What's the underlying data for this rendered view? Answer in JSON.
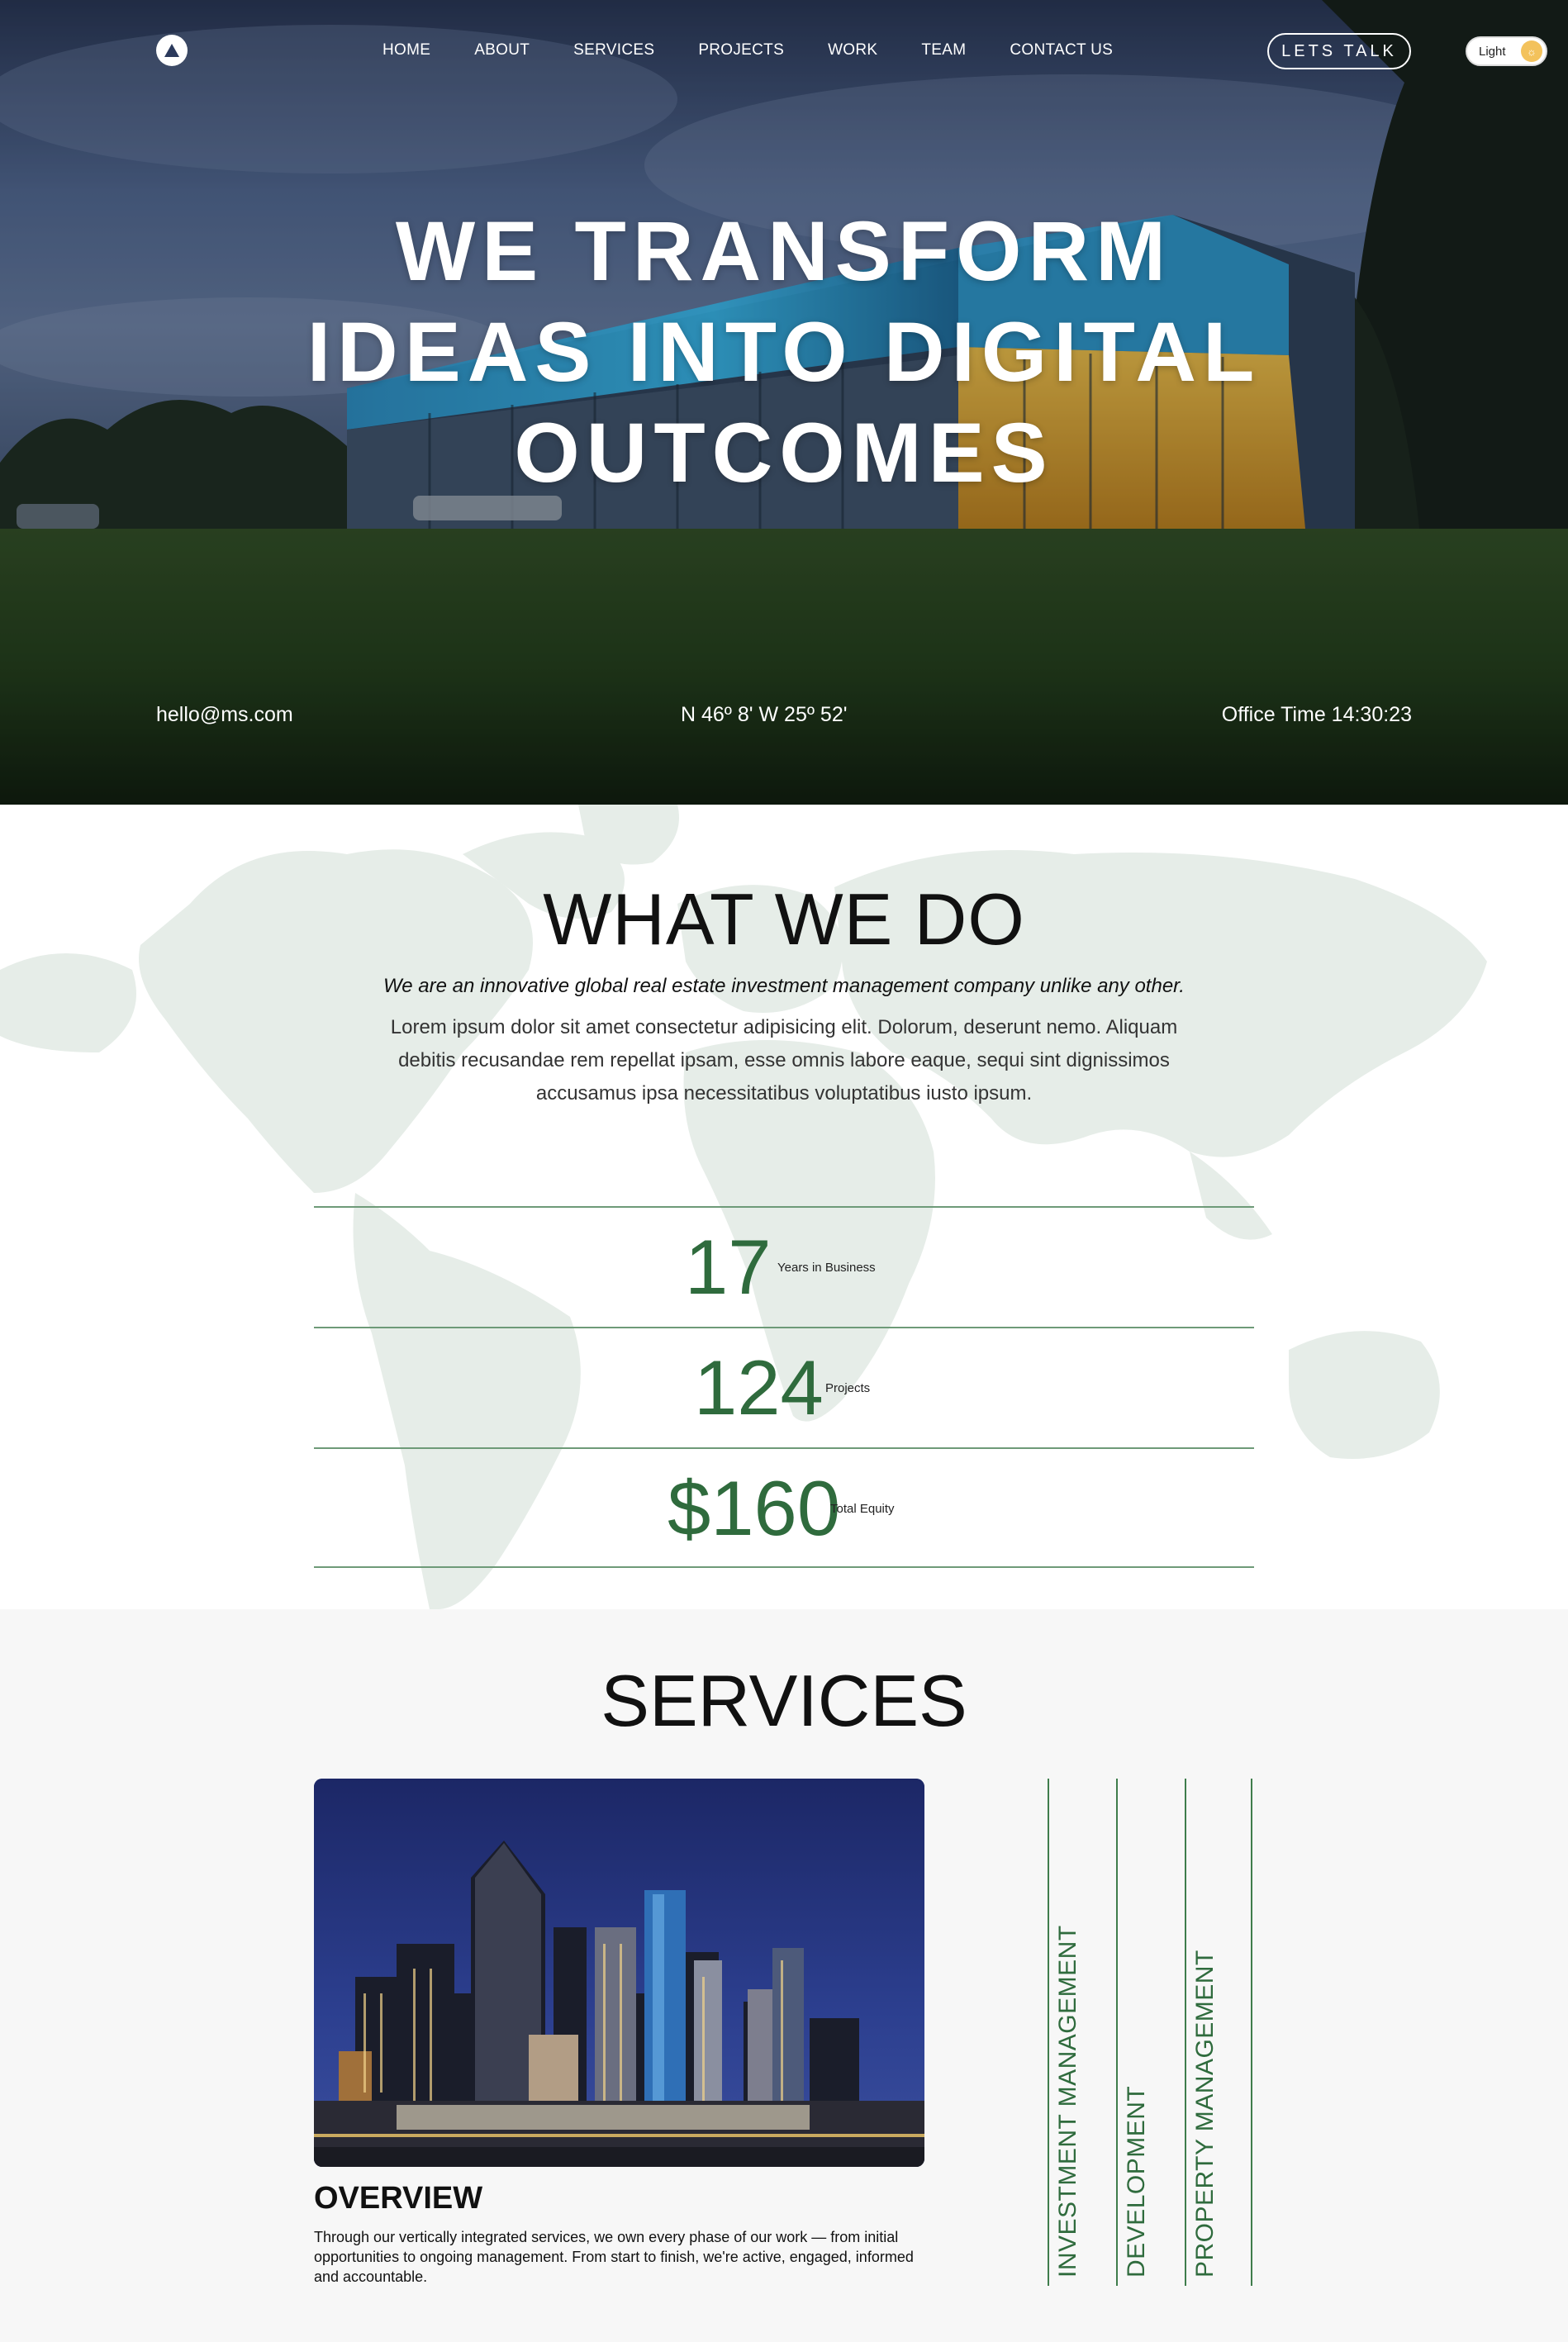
{
  "colors": {
    "accent_green": "#2f6b3d",
    "line_green": "#6e9a78",
    "toggle_knob": "#f3c25c",
    "services_bg": "#f7f7f7"
  },
  "nav": {
    "logo_icon": "triangle-logo-icon",
    "items": [
      {
        "label": "HOME"
      },
      {
        "label": "ABOUT"
      },
      {
        "label": "SERVICES"
      },
      {
        "label": "PROJECTS"
      },
      {
        "label": "WORK"
      },
      {
        "label": "TEAM"
      },
      {
        "label": "CONTACT US"
      }
    ],
    "cta_label": "LETS TALK",
    "theme_toggle_label": "Light",
    "theme_toggle_icon": "sun-icon"
  },
  "hero": {
    "title_lines": [
      "WE TRANSFORM",
      "IDEAS INTO DIGITAL",
      "OUTCOMES"
    ],
    "email": "hello@ms.com",
    "coordinates": "N 46º 8' W 25º 52'",
    "office_time": "Office Time 14:30:23"
  },
  "what_we_do": {
    "title": "WHAT WE DO",
    "lead": "We are an innovative global real estate investment management company unlike any other.",
    "body": "Lorem ipsum dolor sit amet consectetur adipisicing elit. Dolorum, deserunt nemo. Aliquam debitis recusandae rem repellat ipsam, esse omnis labore eaque, sequi sint dignissimos accusamus ipsa necessitatibus voluptatibus iusto ipsum.",
    "stats": [
      {
        "value": "17",
        "label": "Years in Business"
      },
      {
        "value": "124",
        "label": "Projects"
      },
      {
        "value": "$160",
        "label": "Total Equity"
      }
    ]
  },
  "services": {
    "title": "SERVICES",
    "overview_title": "OVERVIEW",
    "overview_text": "Through our vertically integrated services, we own every phase of our work — from initial opportunities to ongoing management. From start to finish, we're active, engaged, informed and accountable.",
    "tabs": [
      {
        "label": "INVESTMENT MANAGEMENT"
      },
      {
        "label": "DEVELOPMENT"
      },
      {
        "label": "PROPERTY MANAGEMENT"
      }
    ]
  }
}
